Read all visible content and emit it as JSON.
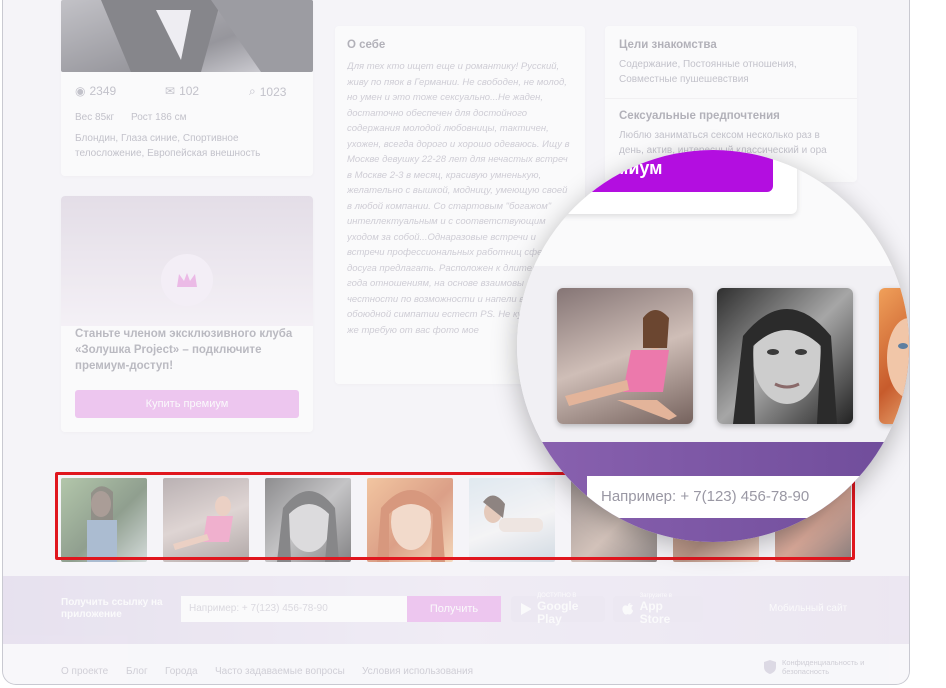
{
  "profile": {
    "views": "2349",
    "messages": "102",
    "searches": "1023",
    "weight": "Вес 85кг",
    "height": "Рост 186 см",
    "traits": "Блондин,  Глаза синие, Спортивное телосложение, Европейская внешность"
  },
  "about": {
    "title": "О себе",
    "text": "Для тех кто ищет еще и романтику! Русский, живу по пяок в Германии. Не свободен, не молод, но умен и это тоже сексуально...Не жаден, достаточно обеспечен для достойного содержания молодой любовницы, тактичен, ухожен, всегда дорого и хорошо одеваюсь. Ищу в Москве девушку 22-28 лет для нечастых встреч в Москве 2-3 в месяц, красивую умненькую, желательно с вышкой, модницу, умеющую своей в любой компании. Со стартовым \"богажом\" интеллектуальным и с соответствующим уходом за собой...Однаразовые встречи и встречи профессиональных работниц сферы досуга предлагать. Расположен к длительным года отношениям, на основе взаимовы честности по возможности и напели все при обоюдной симпатии естест PS. Не курю и того же требую от вас фото мое"
  },
  "goals": {
    "title": "Цели знакомства",
    "text": "Содержание, Постоянные отношения, Совместные пушешевствия",
    "sex_title": "Сексуальные предпочтения",
    "sex_text": "Люблю заниматься сексом несколько раз в день, актив, интересный классический и ора"
  },
  "premium": {
    "text": "Станьте членом эксклюзивного клуба «Золушка Project» – подключите премиум-доступ!",
    "button": "Купить премиум",
    "button_partial": "миум"
  },
  "footer": {
    "get_link": "Получить ссылку на приложение",
    "phone_placeholder": "Например: + 7(123) 456-78-90",
    "get_button": "Получить",
    "google_small": "ДОСТУПНО В",
    "google_big": "Google Play",
    "apple_small": "Загрузите в",
    "apple_big": "App Store",
    "mobile": "Мобильный сайт"
  },
  "links": [
    "О проекте",
    "Блог",
    "Города",
    "Часто задаваемые вопросы",
    "Условия использования"
  ],
  "security": "Конфиденциальность и безопасность",
  "zoom": {
    "phone_placeholder": "Например: + 7(123) 456-78-90"
  },
  "colors": {
    "accent": "#b30ee0",
    "highlight": "#e0161e",
    "purple_band": "#6f4c9a"
  }
}
